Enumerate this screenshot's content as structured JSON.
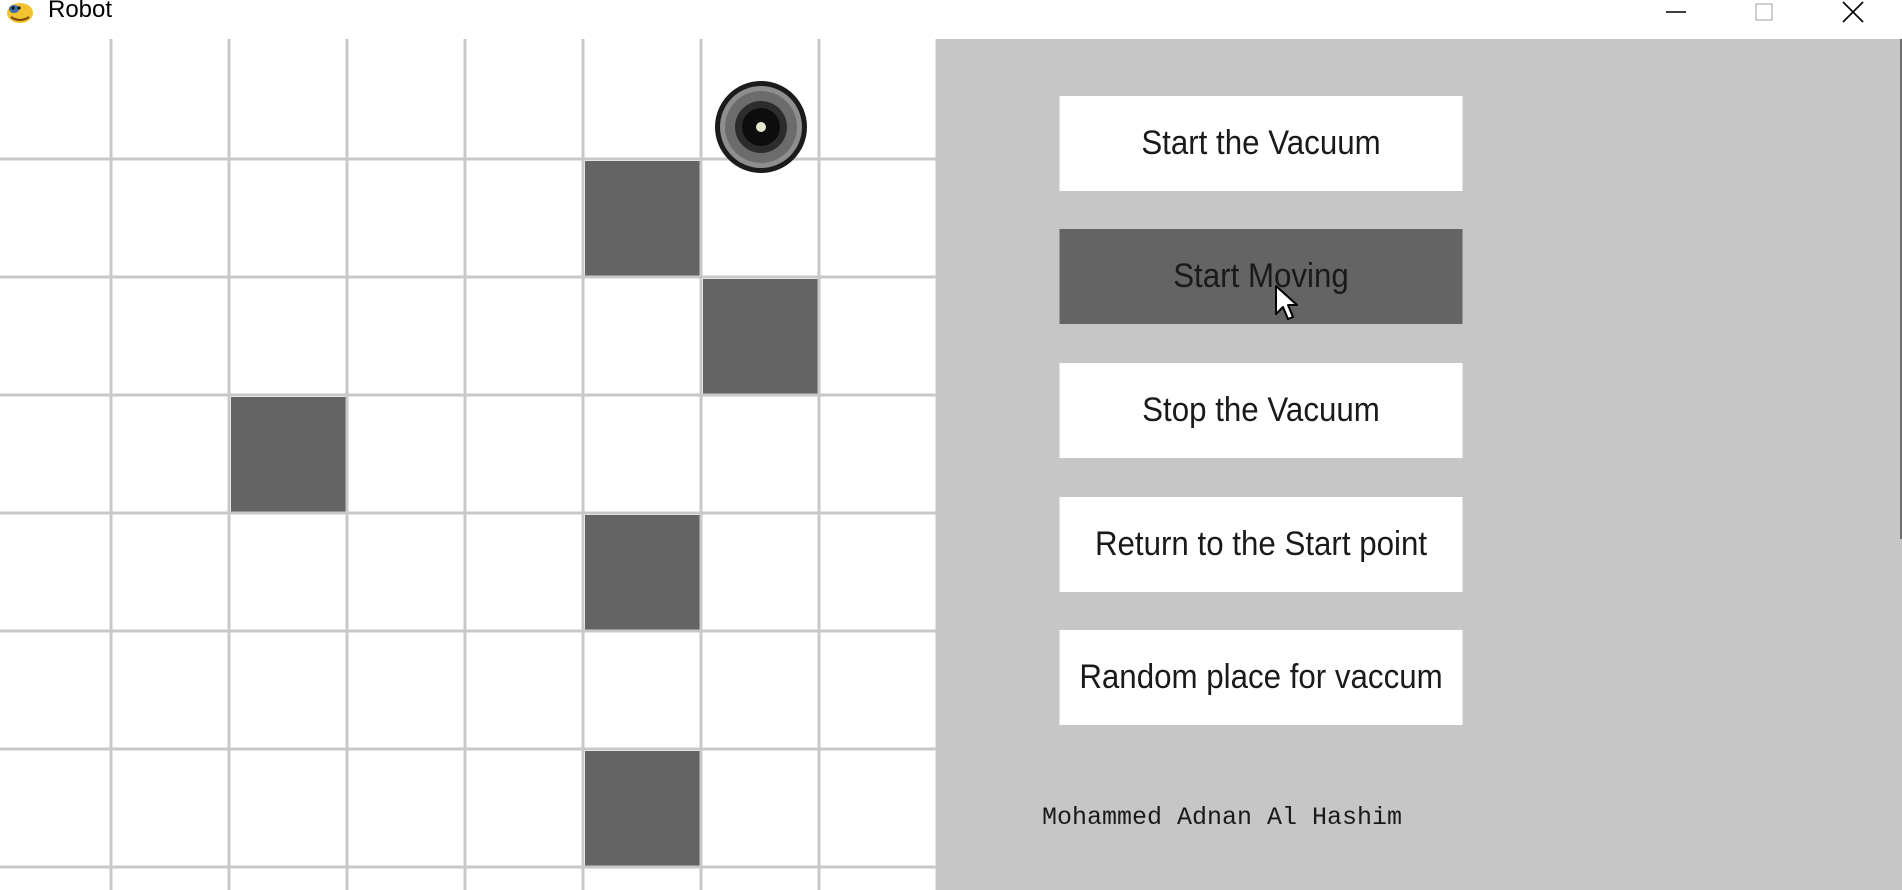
{
  "window": {
    "title": "Robot",
    "controls": [
      "minimize",
      "maximize",
      "close"
    ]
  },
  "grid": {
    "columns": 8,
    "rows": 8,
    "obstacles": [
      {
        "row": 1,
        "col": 5
      },
      {
        "row": 2,
        "col": 6
      },
      {
        "row": 3,
        "col": 2
      },
      {
        "row": 4,
        "col": 5
      },
      {
        "row": 6,
        "col": 5
      }
    ],
    "robot": {
      "row": 0,
      "col": 6
    },
    "colors": {
      "cell": "#ffffff",
      "line": "#c8c8c8",
      "obstacle": "#646464"
    }
  },
  "panel": {
    "buttons": [
      {
        "label": "Start the Vacuum",
        "active": false
      },
      {
        "label": "Start Moving",
        "active": true
      },
      {
        "label": "Stop the Vacuum",
        "active": false
      },
      {
        "label": "Return to the Start point",
        "active": false
      },
      {
        "label": "Random place for vaccum",
        "active": false
      }
    ],
    "author": "Mohammed Adnan Al Hashim",
    "colors": {
      "background": "#c6c6c6",
      "button": "#ffffff",
      "button_active": "#646464"
    }
  }
}
